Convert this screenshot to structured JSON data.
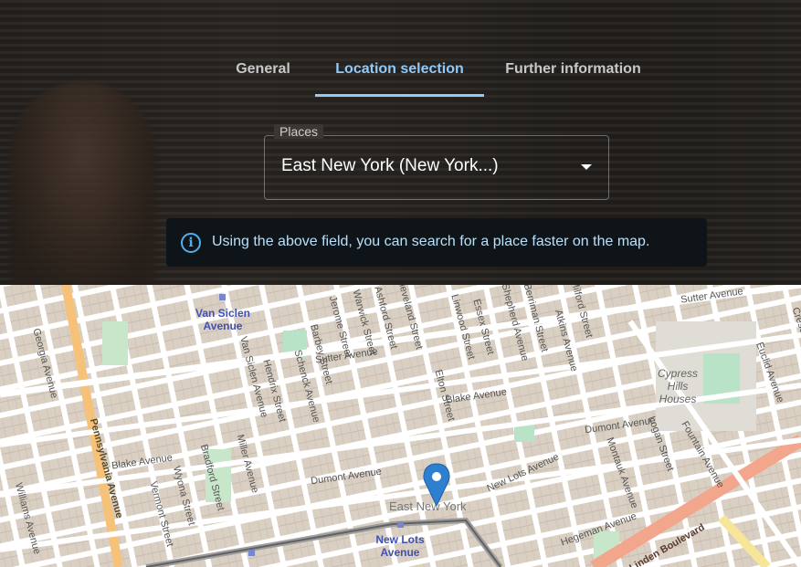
{
  "tabs": [
    {
      "label": "General",
      "active": false
    },
    {
      "label": "Location selection",
      "active": true
    },
    {
      "label": "Further information",
      "active": false
    }
  ],
  "places_field": {
    "label": "Places",
    "value": "East New York (New York...)"
  },
  "info": {
    "icon": "info-icon",
    "text": "Using the above field, you can search for a place faster on the map."
  },
  "map": {
    "marker_icon": "map-pin-icon",
    "streets": [
      "Sutter Avenue",
      "Sutter Avenue",
      "Blake Avenue",
      "Blake Avenue",
      "Dumont Avenue",
      "Dumont Avenue",
      "New Lots Avenue",
      "Hegeman Avenue",
      "Linden Boulevard",
      "Pennsylvania Avenue",
      "Georgia Avenue",
      "Williams Avenue",
      "Vermont Street",
      "Wyona Street",
      "Bradford Street",
      "Miller Avenue",
      "Van Siclen Avenue",
      "Hendrix Street",
      "Schenck Avenue",
      "Barbey Street",
      "Jerome Street",
      "Warwick Street",
      "Ashford Street",
      "Cleveland Street",
      "Elton Street",
      "Linwood Street",
      "Essex Street",
      "Shepherd Avenue",
      "Berriman Street",
      "Atkins Avenue",
      "Fountain Avenue",
      "Logan Street",
      "Montauk Avenue",
      "Euclid Avenue",
      "Crescent Street",
      "Milford Street"
    ],
    "stations": [
      "Van Siclen Avenue",
      "New Lots Avenue"
    ],
    "neighborhoods": [
      "Cypress Hills Houses",
      "East New York"
    ]
  }
}
